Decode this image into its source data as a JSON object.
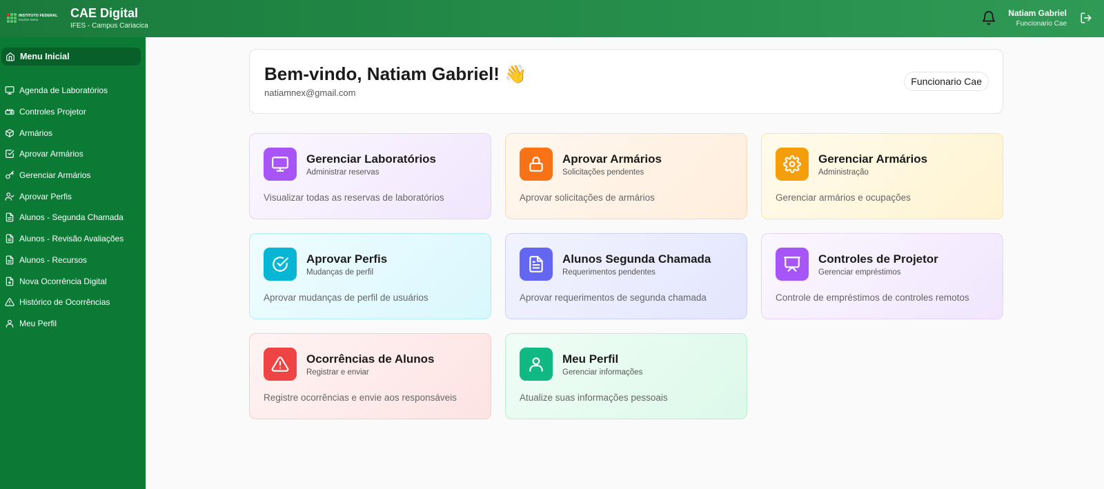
{
  "header": {
    "logo_line1": "INSTITUTO FEDERAL",
    "logo_line2": "Espírito Santo",
    "title": "CAE Digital",
    "subtitle": "IFES - Campus Cariacica",
    "user_name": "Natiam Gabriel",
    "user_role": "Funcionario Cae",
    "bell_icon": "bell-icon",
    "logout_icon": "logout-icon"
  },
  "sidebar": {
    "home": {
      "label": "Menu Inicial",
      "icon": "home-icon"
    },
    "items": [
      {
        "label": "Agenda de Laboratórios",
        "icon": "monitor-icon"
      },
      {
        "label": "Controles Projetor",
        "icon": "projector-icon"
      },
      {
        "label": "Armários",
        "icon": "box-icon"
      },
      {
        "label": "Aprovar Armários",
        "icon": "check-square-icon"
      },
      {
        "label": "Gerenciar Armários",
        "icon": "key-icon"
      },
      {
        "label": "Aprovar Perfis",
        "icon": "user-check-icon"
      },
      {
        "label": "Alunos - Segunda Chamada",
        "icon": "file-icon"
      },
      {
        "label": "Alunos - Revisão Avaliações",
        "icon": "file-icon"
      },
      {
        "label": "Alunos - Recursos",
        "icon": "file-icon"
      },
      {
        "label": "Nova Ocorrência Digital",
        "icon": "file-plus-icon"
      },
      {
        "label": "Histórico de Ocorrências",
        "icon": "alert-triangle-icon"
      },
      {
        "label": "Meu Perfil",
        "icon": "user-icon"
      }
    ]
  },
  "welcome": {
    "title": "Bem-vindo, Natiam Gabriel! 👋",
    "email": "natiamnex@gmail.com",
    "role": "Funcionario Cae"
  },
  "cards": [
    {
      "title": "Gerenciar Laboratórios",
      "subtitle": "Administrar reservas",
      "description": "Visualizar todas as reservas de laboratórios",
      "icon": "monitor-icon",
      "color": "#a855f7"
    },
    {
      "title": "Aprovar Armários",
      "subtitle": "Solicitações pendentes",
      "description": "Aprovar solicitações de armários",
      "icon": "lock-icon",
      "color": "#f97316"
    },
    {
      "title": "Gerenciar Armários",
      "subtitle": "Administração",
      "description": "Gerenciar armários e ocupações",
      "icon": "gear-icon",
      "color": "#f59e0b"
    },
    {
      "title": "Aprovar Perfis",
      "subtitle": "Mudanças de perfil",
      "description": "Aprovar mudanças de perfil de usuários",
      "icon": "check-circle-icon",
      "color": "#06b6d4"
    },
    {
      "title": "Alunos Segunda Chamada",
      "subtitle": "Requerimentos pendentes",
      "description": "Aprovar requerimentos de segunda chamada",
      "icon": "document-icon",
      "color": "#6366f1"
    },
    {
      "title": "Controles de Projetor",
      "subtitle": "Gerenciar empréstimos",
      "description": "Controle de empréstimos de controles remotos",
      "icon": "presentation-icon",
      "color": "#a855f7"
    },
    {
      "title": "Ocorrências de Alunos",
      "subtitle": "Registrar e enviar",
      "description": "Registre ocorrências e envie aos responsáveis",
      "icon": "warning-icon",
      "color": "#ef4444"
    },
    {
      "title": "Meu Perfil",
      "subtitle": "Gerenciar informações",
      "description": "Atualize suas informações pessoais",
      "icon": "user-icon",
      "color": "#10b981"
    }
  ]
}
